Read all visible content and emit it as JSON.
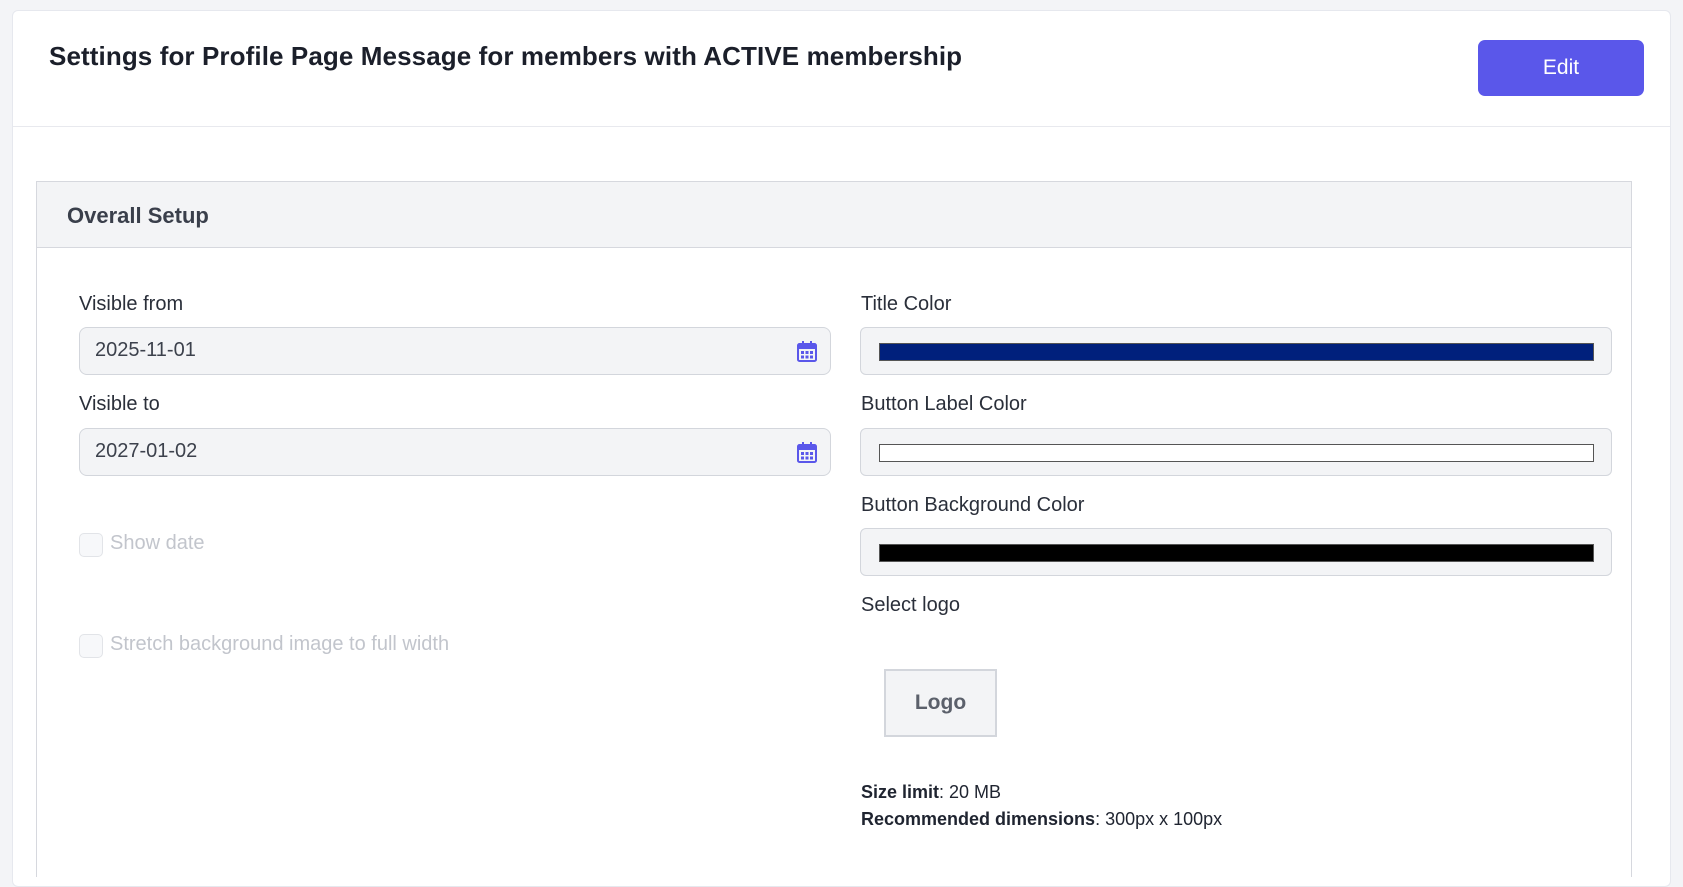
{
  "header": {
    "title": "Settings for Profile Page Message for members with ACTIVE membership",
    "edit_label": "Edit"
  },
  "section": {
    "title": "Overall Setup"
  },
  "left": {
    "visible_from": {
      "label": "Visible from",
      "value": "2025-11-01"
    },
    "visible_to": {
      "label": "Visible to",
      "value": "2027-01-02"
    },
    "show_date": {
      "label": "Show date",
      "checked": false
    },
    "stretch_bg": {
      "label": "Stretch background image to full width",
      "checked": false
    }
  },
  "right": {
    "title_color": {
      "label": "Title Color",
      "value": "#00207c"
    },
    "button_label_color": {
      "label": "Button Label Color",
      "value": "#ffffff"
    },
    "button_bg_color": {
      "label": "Button Background Color",
      "value": "#000000"
    },
    "select_logo": {
      "label": "Select logo",
      "button_label": "Logo"
    },
    "size_limit": {
      "key": "Size limit",
      "value": ": 20 MB"
    },
    "recommended": {
      "key": "Recommended dimensions",
      "value": ": 300px x 100px"
    }
  },
  "colors": {
    "accent": "#5a57ea",
    "calendar_icon": "#5a57ea"
  },
  "icons": {
    "calendar": "calendar-icon"
  }
}
